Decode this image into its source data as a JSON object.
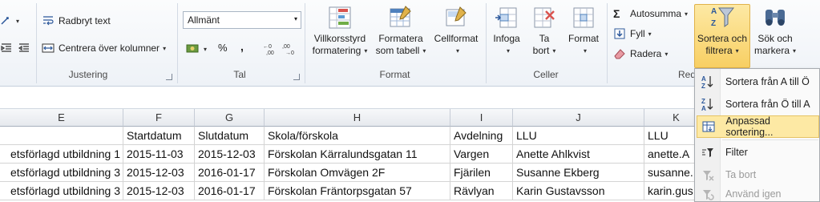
{
  "ribbon": {
    "alignment": {
      "wrap_text": "Radbryt text",
      "merge_center": "Centrera över kolumner",
      "group_label": "Justering"
    },
    "number": {
      "format_value": "Allmänt",
      "percent": "%",
      "comma": ",",
      "group_label": "Tal"
    },
    "styles": {
      "conditional_line1": "Villkorsstyrd",
      "conditional_line2": "formatering",
      "format_table_line1": "Formatera",
      "format_table_line2": "som tabell",
      "cell_styles_line1": "Cellformat",
      "group_label": "Format"
    },
    "cells": {
      "insert": "Infoga",
      "delete_line1": "Ta",
      "delete_line2": "bort",
      "format": "Format",
      "group_label": "Celler"
    },
    "editing": {
      "autosum": "Autosumma",
      "fill": "Fyll",
      "clear": "Radera",
      "sort_line1": "Sortera och",
      "sort_line2": "filtrera",
      "find_line1": "Sök och",
      "find_line2": "markera",
      "group_label_partial": "Red"
    }
  },
  "sheet": {
    "columns": [
      "E",
      "F",
      "G",
      "H",
      "I",
      "J",
      "K"
    ],
    "header_row": [
      "",
      "Startdatum",
      "Slutdatum",
      "Skola/förskola",
      "Avdelning",
      "LLU",
      "LLU"
    ],
    "rows": [
      [
        "etsförlagd utbildning 1",
        "2015-11-03",
        "2015-12-03",
        "Förskolan Kärralundsgatan 11",
        "Vargen",
        "Anette Ahlkvist",
        "anette.A"
      ],
      [
        "etsförlagd utbildning 3",
        "2015-12-03",
        "2016-01-17",
        "Förskolan Omvägen 2F",
        "Fjärilen",
        "Susanne Ekberg",
        "susanne."
      ],
      [
        "etsförlagd utbildning 3",
        "2015-12-03",
        "2016-01-17",
        "Förskolan Fräntorpsgatan 57",
        "Rävlyan",
        "Karin Gustavsson",
        "karin.gus"
      ]
    ]
  },
  "sort_menu": {
    "items": [
      {
        "label": "Sortera från A till Ö",
        "icon": "sort-a-z-icon"
      },
      {
        "label": "Sortera från Ö till A",
        "icon": "sort-z-a-icon"
      },
      {
        "label": "Anpassad sortering...",
        "icon": "custom-sort-icon"
      },
      {
        "label": "Filter",
        "icon": "filter-icon"
      },
      {
        "label": "Ta bort",
        "icon": "clear-filter-icon"
      },
      {
        "label": "Använd igen",
        "icon": "reapply-icon"
      }
    ]
  }
}
